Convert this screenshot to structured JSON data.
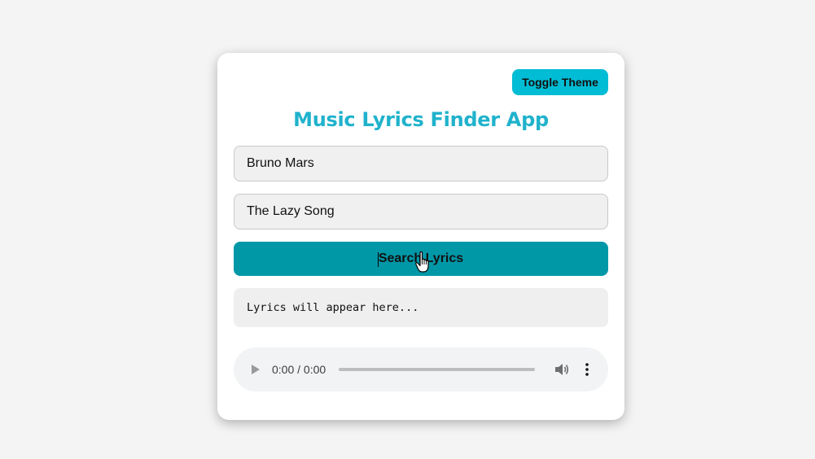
{
  "header": {
    "toggle_label": "Toggle Theme",
    "title": "Music Lyrics Finder App"
  },
  "form": {
    "artist_value": "Bruno Mars",
    "song_value": "The Lazy Song",
    "search_label": "Search Lyrics"
  },
  "lyrics": {
    "placeholder_text": "Lyrics will appear here..."
  },
  "audio_player": {
    "time_display": "0:00 / 0:00",
    "progress": 0,
    "icons": [
      "play-icon",
      "volume-icon",
      "more-options-icon"
    ]
  },
  "colors": {
    "accent": "#00bcd4",
    "title": "#20b2cc",
    "search_button": "#0097a7",
    "page_background": "#f4f4f4"
  }
}
